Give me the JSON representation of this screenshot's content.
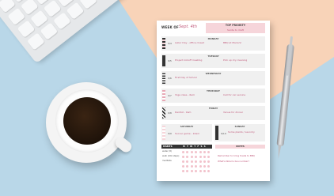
{
  "colors": {
    "background_blue": "#b9d7e8",
    "background_peach": "#f8d3b8",
    "accent_pink": "#f6d5da",
    "accent_text": "#c0587a"
  },
  "planner": {
    "week_label": "WEEK OF",
    "week_value": "Sept. 4th",
    "top_priority": {
      "title": "TOP PRIORITY",
      "value": "Sarita to draft"
    },
    "days": [
      {
        "name": "MONDAY",
        "number": "9/4",
        "note1": "Labor Day - office closed",
        "note2": "BBQ at Maria's!"
      },
      {
        "name": "TUESDAY",
        "number": "9/5",
        "note1": "Project kickoff meeting",
        "note2": "Pick up dry cleaning"
      },
      {
        "name": "WEDNESDAY",
        "number": "9/6",
        "note1": "First Day of School",
        "note2": ""
      },
      {
        "name": "THURSDAY",
        "number": "9/7",
        "note1": "Yoga class - 6am",
        "note2": "Call for car service"
      },
      {
        "name": "FRIDAY",
        "number": "9/8",
        "note1": "Dentist - 9am",
        "note2": "Venue for dinner"
      }
    ],
    "weekend": {
      "saturday": {
        "name": "SATURDAY",
        "number": "9/9",
        "note": "Soccer game - 10am"
      },
      "sunday": {
        "name": "SUNDAY",
        "number": "9/10",
        "note": "Some plants / Laundry"
      }
    },
    "habits": {
      "title": "HABITS",
      "days": "M T W T F S S",
      "items": [
        "water (8)",
        "walk (10k steps)",
        "meditate"
      ]
    },
    "notes": {
      "title": "NOTES",
      "items": [
        "Remember to bring treats to BBQ",
        "What's Nolan's bus number?"
      ]
    }
  }
}
